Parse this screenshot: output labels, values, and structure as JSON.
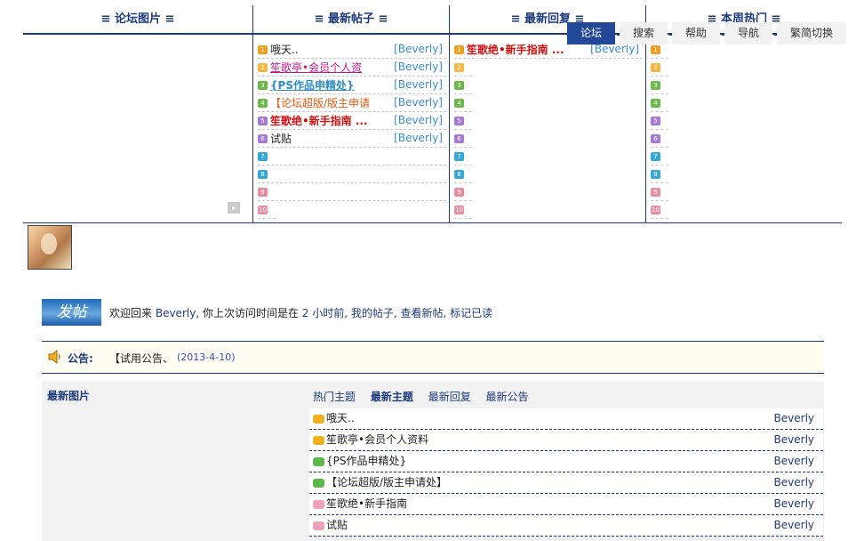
{
  "top_columns": {
    "pictures_header": "≡ 论坛图片 ≡",
    "new_posts_header": "≡ 最新帖子 ≡",
    "new_replies_header": "≡ 最新回复 ≡",
    "weekly_hot_header": "≡ 本周热门 ≡"
  },
  "new_posts": [
    {
      "title": "哦天..",
      "author": "[Beverly]"
    },
    {
      "title": "笙歌亭•会员个人资",
      "author": "[Beverly]"
    },
    {
      "title": "{PS作品申精处}",
      "author": "[Beverly]"
    },
    {
      "title": "【论坛超版/版主申请",
      "author": "[Beverly]"
    },
    {
      "title": "笙歌绝•新手指南 ...",
      "author": "[Beverly]"
    },
    {
      "title": "试贴",
      "author": "[Beverly]"
    }
  ],
  "new_replies": [
    {
      "title": "笙歌绝•新手指南 ...",
      "author": "[Beverly]"
    }
  ],
  "rank_numbers": [
    "1",
    "2",
    "3",
    "4",
    "5",
    "6",
    "7",
    "8",
    "9",
    "10"
  ],
  "nav": {
    "forum": "论坛",
    "search": "搜索",
    "help": "帮助",
    "navigate": "导航",
    "trad_simp": "繁简切换"
  },
  "welcome": {
    "post_button": "发帖",
    "prefix": "欢迎回来",
    "user": "Beverly",
    "mid": ", 你上次访问时间是在",
    "last_visit": "2 小时前",
    "links": ", 我的帖子, 查看新帖, 标记已读"
  },
  "announcement": {
    "label": "公告:",
    "text": "【试用公告、",
    "date": "(2013-4-10)"
  },
  "bottom": {
    "left_title": "最新图片",
    "tabs": [
      "热门主题",
      "最新主题",
      "最新回复",
      "最新公告"
    ],
    "active_tab": "最新主题",
    "rows": [
      {
        "title": "哦天..",
        "author": "Beverly",
        "icon_color": "#f0b020"
      },
      {
        "title": "笙歌亭•会员个人资料",
        "author": "Beverly",
        "icon_color": "#f0b020"
      },
      {
        "title": "{PS作品申精处}",
        "author": "Beverly",
        "icon_color": "#5cb84a"
      },
      {
        "title": "【论坛超版/版主申请处】",
        "author": "Beverly",
        "icon_color": "#5cb84a"
      },
      {
        "title": "笙歌绝•新手指南",
        "author": "Beverly",
        "icon_color": "#f0a0b8"
      },
      {
        "title": "试贴",
        "author": "Beverly",
        "icon_color": "#f0a0b8"
      }
    ]
  },
  "colors": {
    "primary": "#1d3a7a",
    "nav_active": "#23489a",
    "author_link": "#3a8ad8",
    "hot_red": "#d41010"
  }
}
